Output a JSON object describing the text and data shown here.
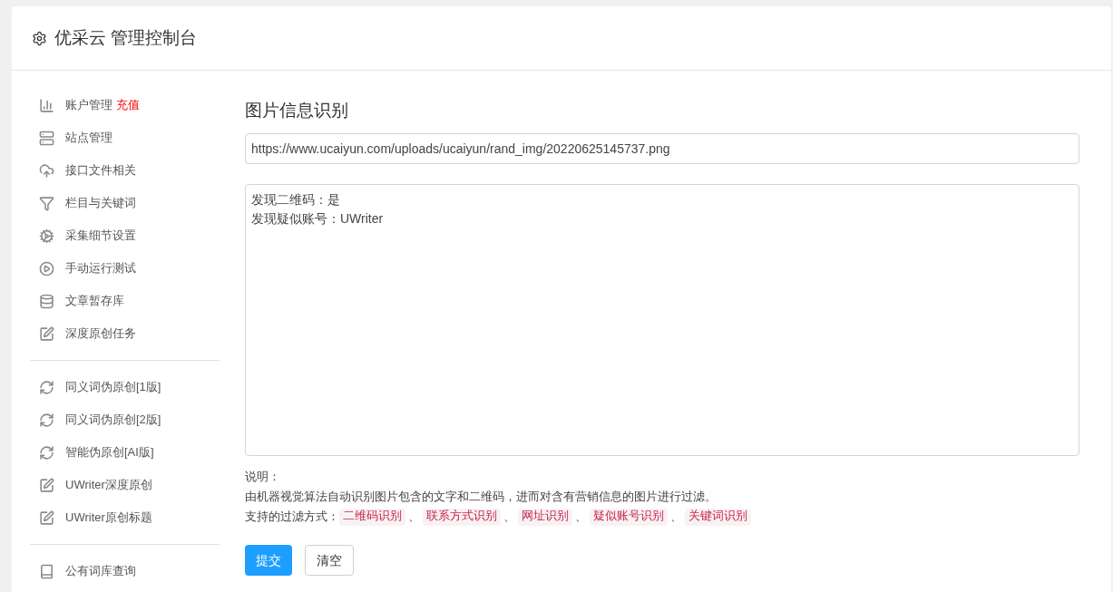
{
  "header": {
    "title": "优采云 管理控制台"
  },
  "sidebar": {
    "groups": [
      {
        "items": [
          {
            "label": "账户管理",
            "badge": "充值"
          },
          {
            "label": "站点管理"
          },
          {
            "label": "接口文件相关"
          },
          {
            "label": "栏目与关键词"
          },
          {
            "label": "采集细节设置"
          },
          {
            "label": "手动运行测试"
          },
          {
            "label": "文章暂存库"
          },
          {
            "label": "深度原创任务"
          }
        ]
      },
      {
        "items": [
          {
            "label": "同义词伪原创[1版]"
          },
          {
            "label": "同义词伪原创[2版]"
          },
          {
            "label": "智能伪原创[AI版]"
          },
          {
            "label": "UWriter深度原创"
          },
          {
            "label": "UWriter原创标题"
          }
        ]
      },
      {
        "items": [
          {
            "label": "公有词库查询"
          }
        ]
      }
    ]
  },
  "main": {
    "title": "图片信息识别",
    "url_field": {
      "value": "https://www.ucaiyun.com/uploads/ucaiyun/rand_img/20220625145737.png"
    },
    "result_field": {
      "lines": [
        "发现二维码：是",
        "发现疑似账号：UWriter"
      ]
    },
    "note_label": "说明：",
    "description": "由机器视觉算法自动识别图片包含的文字和二维码，进而对含有营销信息的图片进行过滤。",
    "filters_label": "支持的过滤方式：",
    "filters": [
      "二维码识别",
      "联系方式识别",
      "网址识别",
      "疑似账号识别",
      "关键词识别"
    ],
    "filter_separator": "、",
    "buttons": [
      {
        "label": "提交",
        "kind": "primary"
      },
      {
        "label": "清空",
        "kind": "default"
      }
    ]
  }
}
